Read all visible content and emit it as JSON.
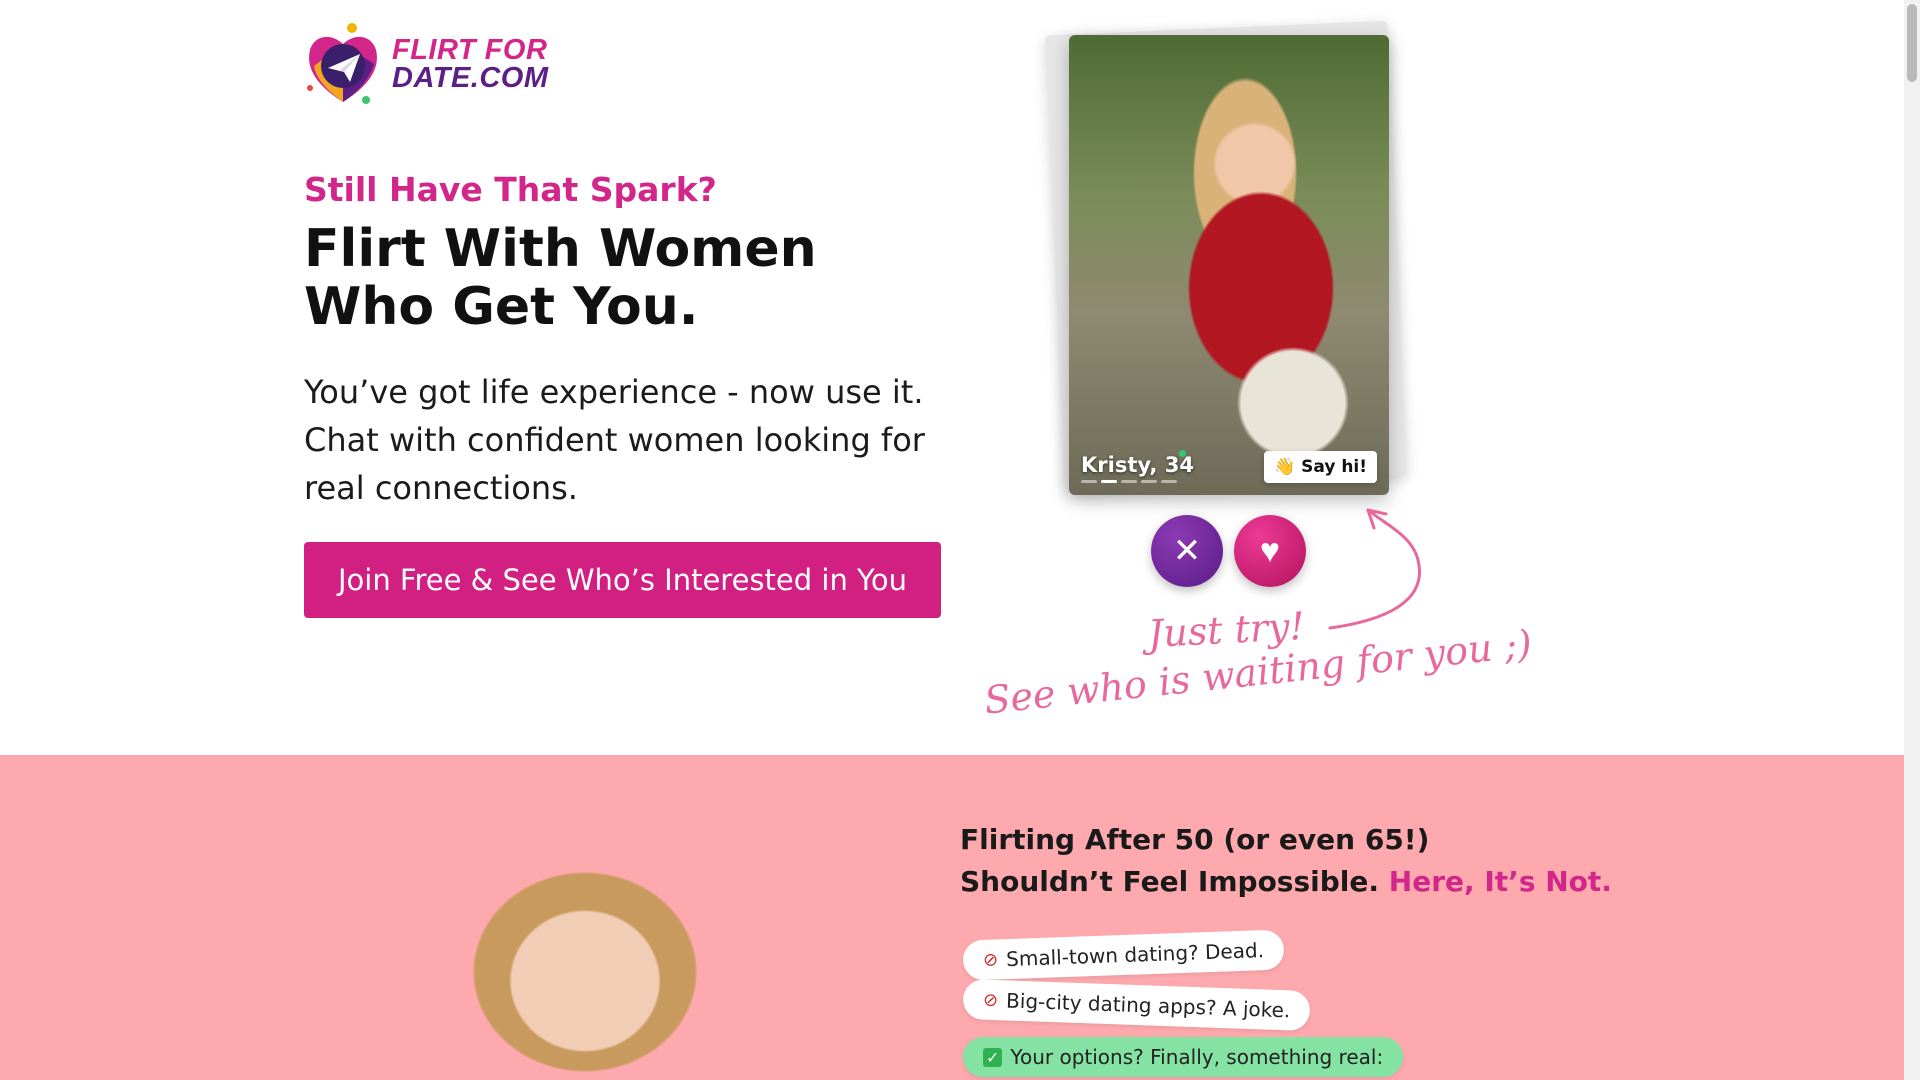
{
  "brand": {
    "line1": "FLIRT FOR",
    "line2": "DATE.COM",
    "icon": "paper-plane-heart-icon",
    "colors": {
      "pink": "#d2268a",
      "purple": "#5b1f86"
    }
  },
  "hero": {
    "eyebrow": "Still Have That Spark?",
    "headline_line1": "Flirt With Women",
    "headline_line2": "Who Get You.",
    "subtext": "You’ve got life experience - now use it. Chat with confident women looking for real connections.",
    "cta_label": "Join Free & See Who’s Interested in You",
    "cta_color": "#d11f82"
  },
  "profile_card": {
    "name": "Kristy, 34",
    "say_hi_label": "Say hi!",
    "say_hi_icon": "waving-hand-icon",
    "dislike_icon": "close-icon",
    "like_icon": "heart-icon"
  },
  "handwritten": {
    "line1": "Just try!",
    "line2": "See who is waiting for you ;)"
  },
  "section2": {
    "title_line1": "Flirting After 50 (or even 65!)",
    "title_line2": "Shouldn’t Feel Impossible.",
    "title_accent": "Here, It’s Not.",
    "pills": [
      {
        "icon": "prohibited-icon",
        "text": "Small-town dating? Dead."
      },
      {
        "icon": "prohibited-icon",
        "text": "Big-city dating apps? A joke."
      },
      {
        "icon": "check-mark-icon",
        "text": "Your options? Finally, something real:"
      }
    ],
    "background": "#fda9ad"
  }
}
